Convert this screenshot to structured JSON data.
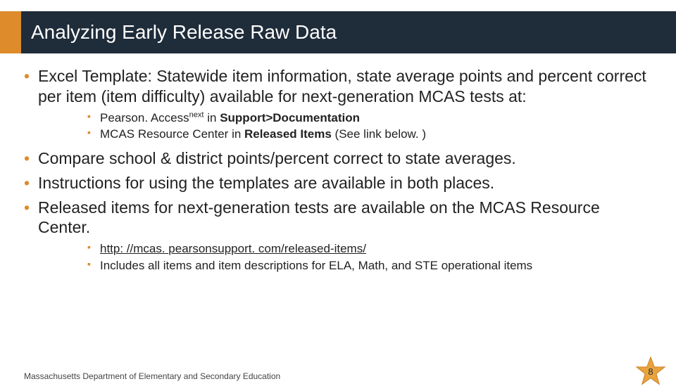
{
  "title": "Analyzing Early Release Raw Data",
  "bullets": {
    "b1": "Excel Template: Statewide item information, state average points and percent correct per item (item difficulty) available for next-generation MCAS tests at:",
    "s1a_prefix": "Pearson. Access",
    "s1a_sup": "next",
    "s1a_mid": " in ",
    "s1a_bold": "Support>Documentation",
    "s1b_prefix": "MCAS Resource Center in ",
    "s1b_bold": "Released Items",
    "s1b_suffix": " (See link below. )",
    "b2": "Compare school & district points/percent correct to state averages.",
    "b3": "Instructions for using the templates are available in both places.",
    "b4": "Released items for next-generation tests are available on the MCAS Resource Center.",
    "s4a": "http: //mcas. pearsonsupport. com/released-items/",
    "s4b": "Includes all items and item descriptions for ELA, Math, and STE operational items"
  },
  "footer": "Massachusetts Department of Elementary and Secondary Education",
  "page_number": "8"
}
